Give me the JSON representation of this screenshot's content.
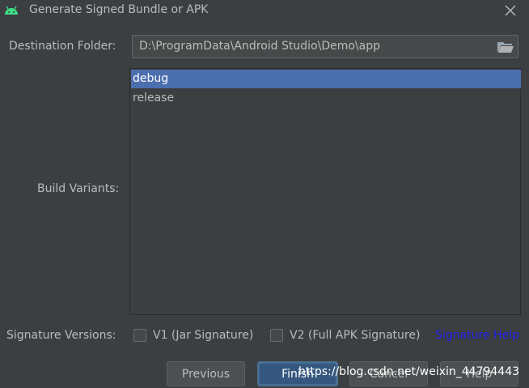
{
  "window": {
    "title": "Generate Signed Bundle or APK",
    "app_icon": "android-icon",
    "close_icon": "close-icon"
  },
  "destination": {
    "label": "Destination Folder:",
    "value": "D:\\ProgramData\\Android Studio\\Demo\\app",
    "browse_icon": "folder-open-icon"
  },
  "build_variants": {
    "label": "Build Variants:",
    "items": [
      {
        "label": "debug",
        "selected": true
      },
      {
        "label": "release",
        "selected": false
      }
    ]
  },
  "signature": {
    "label": "Signature Versions:",
    "v1_label": "V1 (Jar Signature)",
    "v1_checked": false,
    "v2_label": "V2 (Full APK Signature)",
    "v2_checked": false,
    "help_link": "Signature Help"
  },
  "buttons": {
    "previous": "Previous",
    "finish": "Finish",
    "cancel": "Cancel",
    "help": "Help"
  },
  "watermark": "https://blog.csdn.net/weixin_44794443",
  "colors": {
    "background": "#3c3f41",
    "selection": "#4b6eaf",
    "link": "#1e1eee",
    "text": "#bbbbbb",
    "android_green": "#3ddc84"
  }
}
